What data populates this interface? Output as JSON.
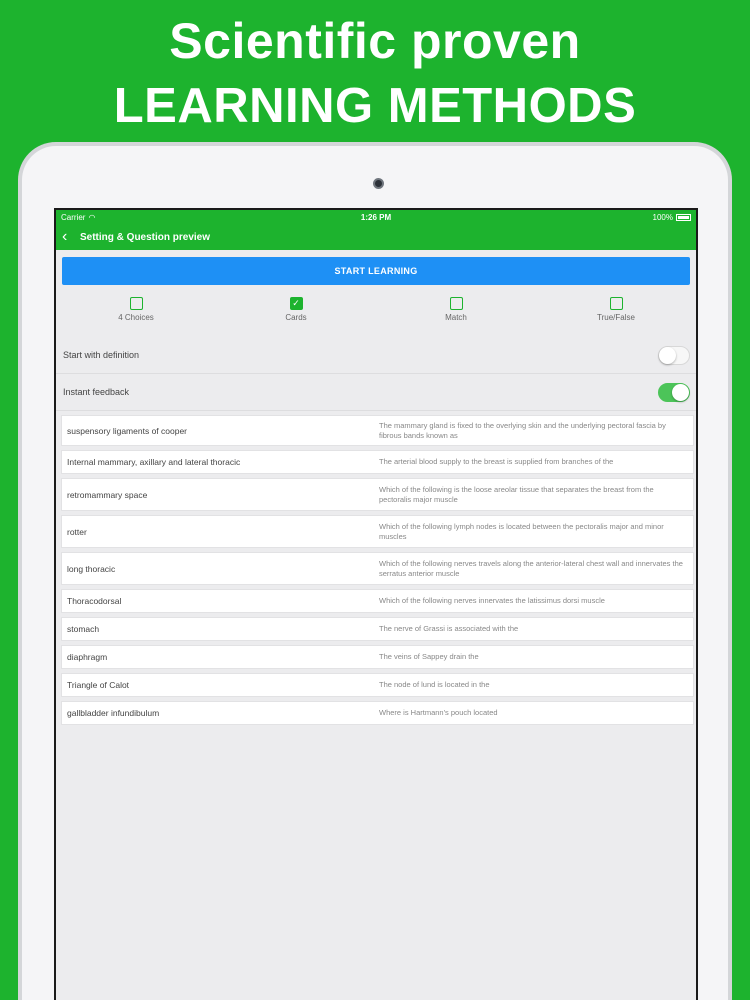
{
  "headline": {
    "line1": "Scientific proven",
    "line2": "LEARNING METHODS"
  },
  "colors": {
    "brand_green": "#1db32e",
    "button_blue": "#1e90f5",
    "switch_on": "#4cc459"
  },
  "status_bar": {
    "carrier": "Carrier",
    "time": "1:26 PM",
    "battery": "100%"
  },
  "nav": {
    "title": "Setting & Question preview",
    "back_icon": "chevron-left-icon"
  },
  "start_button": "START LEARNING",
  "modes": [
    {
      "label": "4 Choices",
      "checked": false
    },
    {
      "label": "Cards",
      "checked": true
    },
    {
      "label": "Match",
      "checked": false
    },
    {
      "label": "True/False",
      "checked": false
    }
  ],
  "settings": [
    {
      "label": "Start with definition",
      "on": false
    },
    {
      "label": "Instant feedback",
      "on": true
    }
  ],
  "cards": [
    {
      "term": "suspensory ligaments of cooper",
      "definition": "The mammary gland is fixed to the overlying skin and the underlying pectoral fascia by fibrous bands known as"
    },
    {
      "term": "Internal mammary, axillary and lateral thoracic",
      "definition": "The arterial blood supply to the breast is supplied from branches of the"
    },
    {
      "term": "retromammary space",
      "definition": "Which of the following is the loose areolar tissue that separates the breast from the pectoralis major muscle"
    },
    {
      "term": "rotter",
      "definition": "Which of the following lymph nodes is located between the pectoralis major and minor muscles"
    },
    {
      "term": "long thoracic",
      "definition": "Which of the following nerves travels along the anterior-lateral chest wall and innervates the serratus anterior muscle"
    },
    {
      "term": "Thoracodorsal",
      "definition": "Which of the following nerves innervates the latissimus dorsi muscle"
    },
    {
      "term": "stomach",
      "definition": "The nerve of Grassi is associated with the"
    },
    {
      "term": "diaphragm",
      "definition": "The veins of Sappey drain the"
    },
    {
      "term": "Triangle of Calot",
      "definition": "The node of lund is located in the"
    },
    {
      "term": "gallbladder infundibulum",
      "definition": "Where is Hartmann's pouch located"
    }
  ]
}
